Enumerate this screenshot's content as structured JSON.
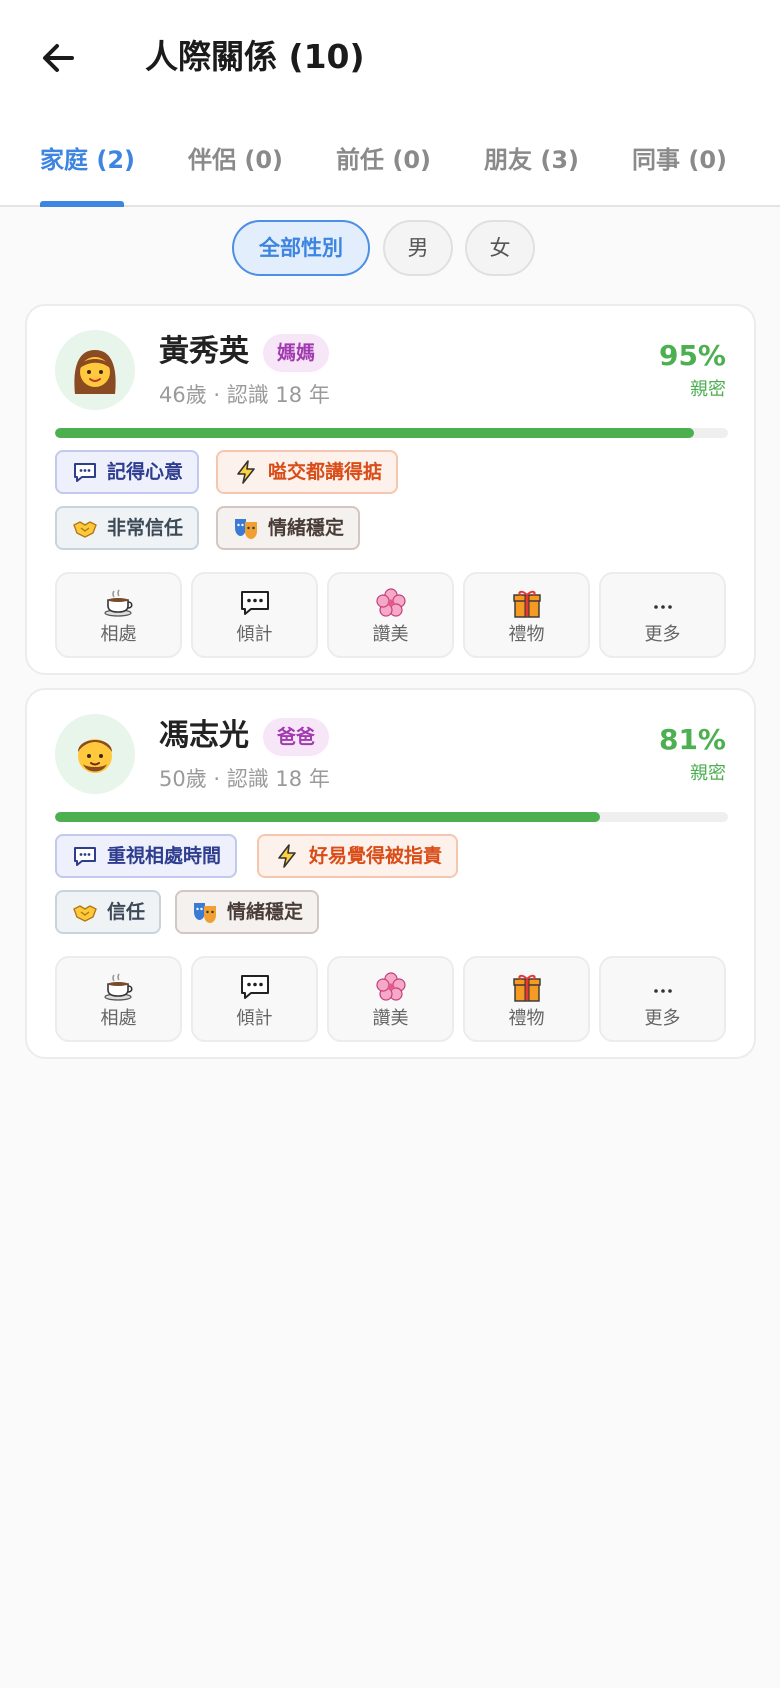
{
  "header": {
    "title": "人際關係 (10)"
  },
  "tabs": [
    {
      "label": "家庭 (2)",
      "active": true
    },
    {
      "label": "伴侶 (0)",
      "active": false
    },
    {
      "label": "前任 (0)",
      "active": false
    },
    {
      "label": "朋友 (3)",
      "active": false
    },
    {
      "label": "同事 (0)",
      "active": false
    }
  ],
  "gender_filter": [
    {
      "label": "全部性別",
      "selected": true
    },
    {
      "label": "男",
      "selected": false
    },
    {
      "label": "女",
      "selected": false
    }
  ],
  "people": [
    {
      "name": "黃秀英",
      "avatar_icon": "woman-face-icon",
      "role": "媽媽",
      "meta": "46歲 · 認識 18 年",
      "intimacy_percent_text": "95%",
      "intimacy_value": 0.95,
      "intimacy_label": "親密",
      "tags": [
        {
          "icon": "speech-bubble-icon",
          "label": "記得心意",
          "tone": "blue"
        },
        {
          "icon": "lightning-icon",
          "label": "嗌交都講得掂",
          "tone": "orange"
        },
        {
          "icon": "handshake-icon",
          "label": "非常信任",
          "tone": "grey"
        },
        {
          "icon": "theater-masks-icon",
          "label": "情緒穩定",
          "tone": "brown"
        }
      ]
    },
    {
      "name": "馮志光",
      "avatar_icon": "man-face-icon",
      "role": "爸爸",
      "meta": "50歲 · 認識 18 年",
      "intimacy_percent_text": "81%",
      "intimacy_value": 0.81,
      "intimacy_label": "親密",
      "tags": [
        {
          "icon": "speech-bubble-icon",
          "label": "重視相處時間",
          "tone": "blue"
        },
        {
          "icon": "lightning-icon",
          "label": "好易覺得被指責",
          "tone": "orange"
        },
        {
          "icon": "handshake-icon",
          "label": "信任",
          "tone": "grey"
        },
        {
          "icon": "theater-masks-icon",
          "label": "情緒穩定",
          "tone": "brown"
        }
      ]
    }
  ],
  "actions": [
    {
      "icon": "coffee-cup-icon",
      "label": "相處"
    },
    {
      "icon": "chat-bubble-icon",
      "label": "傾計"
    },
    {
      "icon": "flower-icon",
      "label": "讚美"
    },
    {
      "icon": "gift-icon",
      "label": "禮物"
    },
    {
      "icon": "more-icon",
      "label": "更多"
    }
  ],
  "colors": {
    "accent": "#3d85e0",
    "intimacy_green": "#4caf50",
    "role_badge": "#a23bb0"
  }
}
